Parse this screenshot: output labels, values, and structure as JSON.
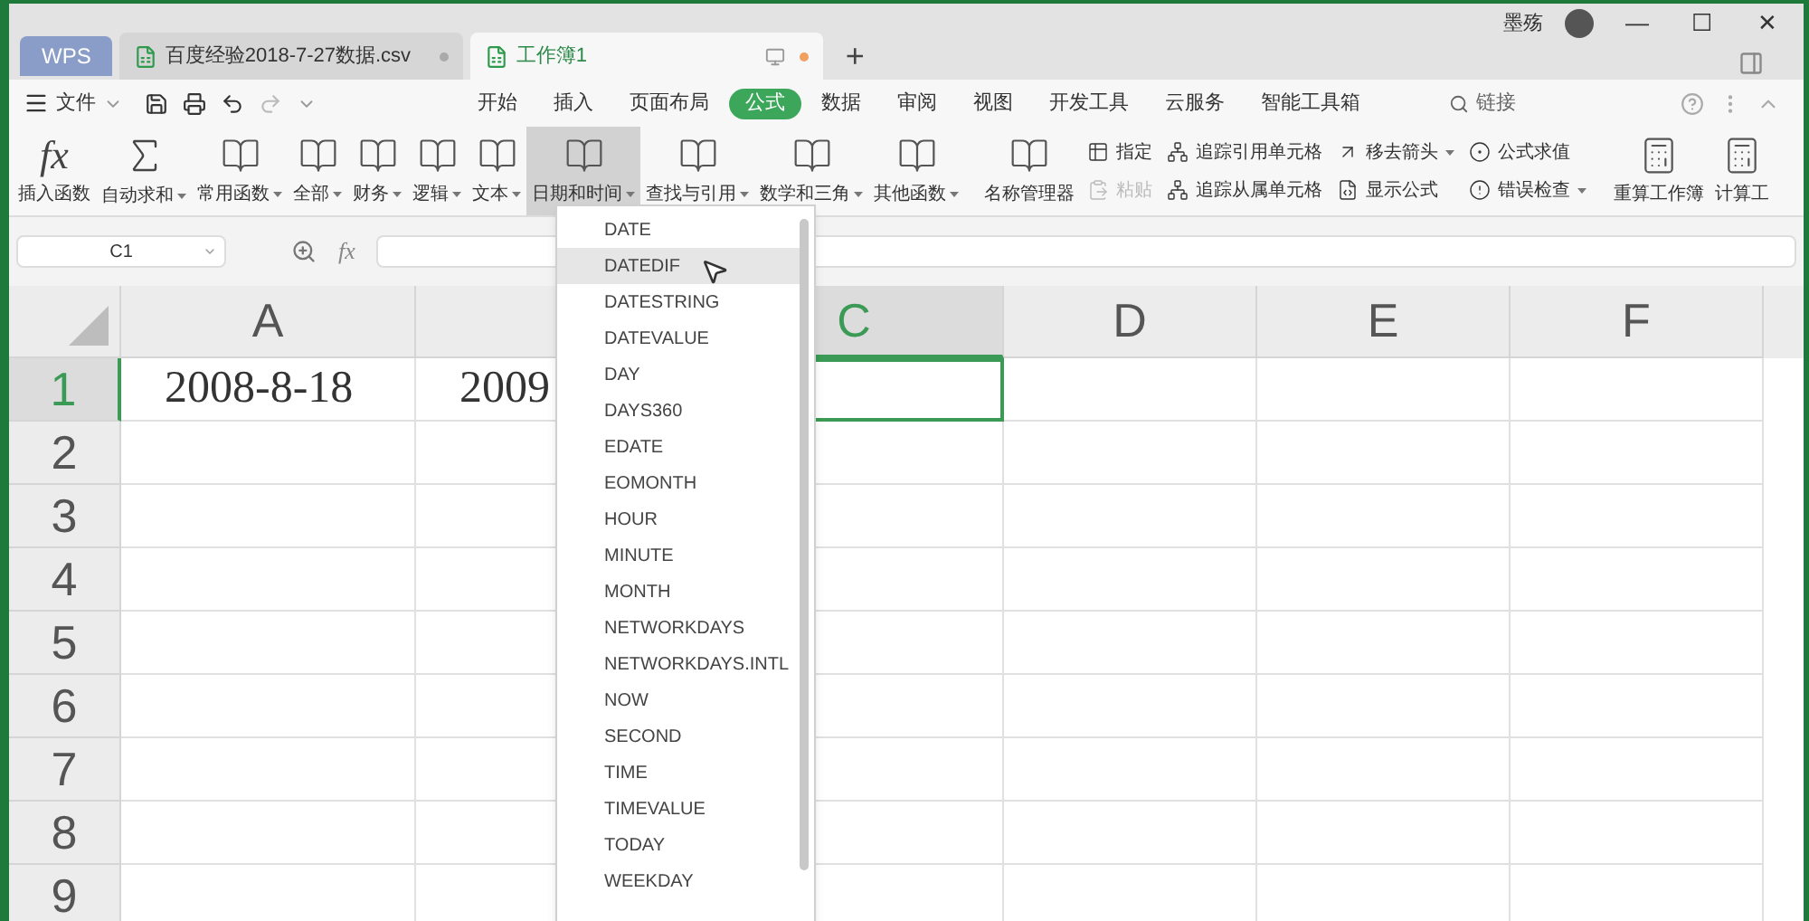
{
  "window": {
    "user": "墨殇",
    "controls": [
      "—",
      "☐",
      "✕"
    ]
  },
  "tabs": [
    {
      "kind": "app",
      "label": "WPS",
      "selected": false
    },
    {
      "kind": "doc",
      "label": "百度经验2018-7-27数据.csv",
      "selected": false
    },
    {
      "kind": "doc",
      "label": "工作簿1",
      "selected": true
    }
  ],
  "new_tab": "+",
  "menu": {
    "file": "文件",
    "items": [
      {
        "label": "开始",
        "selected": false
      },
      {
        "label": "插入",
        "selected": false
      },
      {
        "label": "页面布局",
        "selected": false
      },
      {
        "label": "公式",
        "selected": true
      },
      {
        "label": "数据",
        "selected": false
      },
      {
        "label": "审阅",
        "selected": false
      },
      {
        "label": "视图",
        "selected": false
      },
      {
        "label": "开发工具",
        "selected": false
      },
      {
        "label": "云服务",
        "selected": false
      },
      {
        "label": "智能工具箱",
        "selected": false
      }
    ],
    "search": "链接"
  },
  "ribbon": [
    {
      "kind": "fx",
      "label": "插入函数",
      "dropdown": false,
      "selected": false
    },
    {
      "kind": "sum",
      "label": "自动求和",
      "dropdown": true,
      "selected": false
    },
    {
      "kind": "func",
      "label": "常用函数",
      "dropdown": true,
      "selected": false
    },
    {
      "kind": "func",
      "label": "全部",
      "dropdown": true,
      "selected": false
    },
    {
      "kind": "func",
      "label": "财务",
      "dropdown": true,
      "selected": false
    },
    {
      "kind": "func",
      "label": "逻辑",
      "dropdown": true,
      "selected": false
    },
    {
      "kind": "func",
      "label": "文本",
      "dropdown": true,
      "selected": false
    },
    {
      "kind": "func",
      "label": "日期和时间",
      "dropdown": true,
      "selected": true
    },
    {
      "kind": "func",
      "label": "查找与引用",
      "dropdown": true,
      "selected": false
    },
    {
      "kind": "func",
      "label": "数学和三角",
      "dropdown": true,
      "selected": false
    },
    {
      "kind": "func",
      "label": "其他函数",
      "dropdown": true,
      "selected": false
    },
    {
      "kind": "func",
      "label": "名称管理器",
      "dropdown": false,
      "selected": false
    },
    {
      "kind": "pair",
      "items": [
        {
          "label": "指定",
          "dropdown": false,
          "disabled": false
        },
        {
          "label": "粘贴",
          "dropdown": false,
          "disabled": true
        }
      ]
    },
    {
      "kind": "pair",
      "items": [
        {
          "label": "追踪引用单元格",
          "dropdown": false,
          "disabled": false
        },
        {
          "label": "追踪从属单元格",
          "dropdown": false,
          "disabled": false
        }
      ]
    },
    {
      "kind": "pair",
      "items": [
        {
          "label": "移去箭头",
          "dropdown": true,
          "disabled": false
        },
        {
          "label": "显示公式",
          "dropdown": false,
          "disabled": false
        }
      ]
    },
    {
      "kind": "pair",
      "items": [
        {
          "label": "公式求值",
          "dropdown": false,
          "disabled": false
        },
        {
          "label": "错误检查",
          "dropdown": true,
          "disabled": false
        }
      ]
    },
    {
      "kind": "calc",
      "label": "重算工作簿",
      "dropdown": false,
      "selected": false
    },
    {
      "kind": "calc",
      "label": "计算工",
      "dropdown": false,
      "selected": false
    }
  ],
  "formula_bar": {
    "name_box": "C1",
    "fx": "fx"
  },
  "sheet": {
    "columns": [
      {
        "label": "A",
        "selected": false
      },
      {
        "selected": false
      },
      {
        "label": "C",
        "selected": true
      },
      {
        "label": "D",
        "selected": false
      },
      {
        "label": "E",
        "selected": false
      },
      {
        "label": "F",
        "selected": false
      }
    ],
    "rows": [
      {
        "label": "1",
        "selected": true,
        "cells": [
          "2008-8-18",
          "2009",
          "",
          "",
          "",
          ""
        ]
      },
      {
        "label": "2",
        "selected": false,
        "cells": []
      },
      {
        "label": "3",
        "selected": false,
        "cells": []
      },
      {
        "label": "4",
        "selected": false,
        "cells": []
      },
      {
        "label": "5",
        "selected": false,
        "cells": []
      },
      {
        "label": "6",
        "selected": false,
        "cells": []
      },
      {
        "label": "7",
        "selected": false,
        "cells": []
      },
      {
        "label": "8",
        "selected": false,
        "cells": []
      },
      {
        "label": "9",
        "selected": false,
        "cells": []
      }
    ]
  },
  "dropdown": [
    {
      "label": "DATE",
      "selected": false
    },
    {
      "label": "DATEDIF",
      "selected": true
    },
    {
      "label": "DATESTRING",
      "selected": false
    },
    {
      "label": "DATEVALUE",
      "selected": false
    },
    {
      "label": "DAY",
      "selected": false
    },
    {
      "label": "DAYS360",
      "selected": false
    },
    {
      "label": "EDATE",
      "selected": false
    },
    {
      "label": "EOMONTH",
      "selected": false
    },
    {
      "label": "HOUR",
      "selected": false
    },
    {
      "label": "MINUTE",
      "selected": false
    },
    {
      "label": "MONTH",
      "selected": false
    },
    {
      "label": "NETWORKDAYS",
      "selected": false
    },
    {
      "label": "NETWORKDAYS.INTL",
      "selected": false
    },
    {
      "label": "NOW",
      "selected": false
    },
    {
      "label": "SECOND",
      "selected": false
    },
    {
      "label": "TIME",
      "selected": false
    },
    {
      "label": "TIMEVALUE",
      "selected": false
    },
    {
      "label": "TODAY",
      "selected": false
    },
    {
      "label": "WEEKDAY",
      "selected": false
    }
  ]
}
